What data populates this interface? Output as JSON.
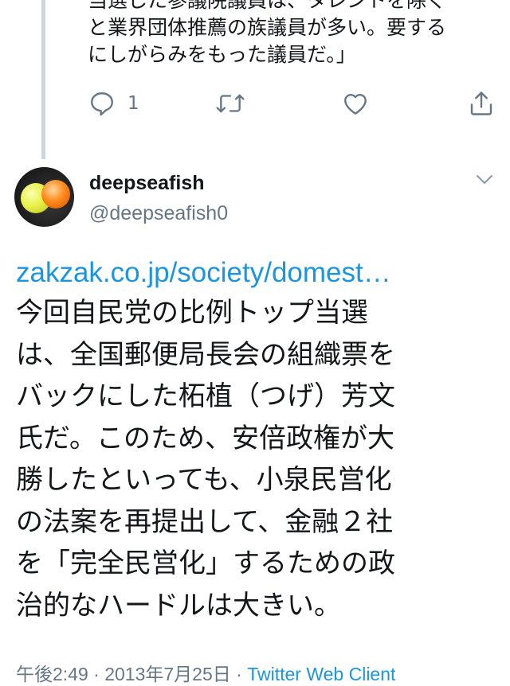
{
  "previous_tweet": {
    "text_lines": [
      "当選した参議院議員は、タレントを除く",
      "と業界団体推薦の族議員が多い。要する",
      "にしがらみをもった議員だ。」"
    ],
    "reply_count": "1",
    "icons": {
      "reply": "reply-icon",
      "retweet": "retweet-icon",
      "like": "like-icon",
      "share": "share-icon"
    }
  },
  "tweet": {
    "author": {
      "display_name": "deepseafish",
      "handle": "@deepseafish0"
    },
    "link_text": "zakzak.co.jp/society/domest…",
    "body_lines": [
      "今回自民党の比例トップ当選",
      "は、全国郵便局長会の組織票を",
      "バックにした柘植（つげ）芳文",
      "氏だ。このため、安倍政権が大",
      "勝したといっても、小泉民営化",
      "の法案を再提出して、金融２社",
      "を「完全民営化」するための政",
      "治的なハードルは大きい。"
    ],
    "time": "午後2:49",
    "separator": " · ",
    "date": "2013年7月25日",
    "client": "Twitter Web Client"
  },
  "colors": {
    "text": "#14171a",
    "secondary": "#657786",
    "link": "#1b95e0",
    "thread_line": "#ccd6dd"
  }
}
